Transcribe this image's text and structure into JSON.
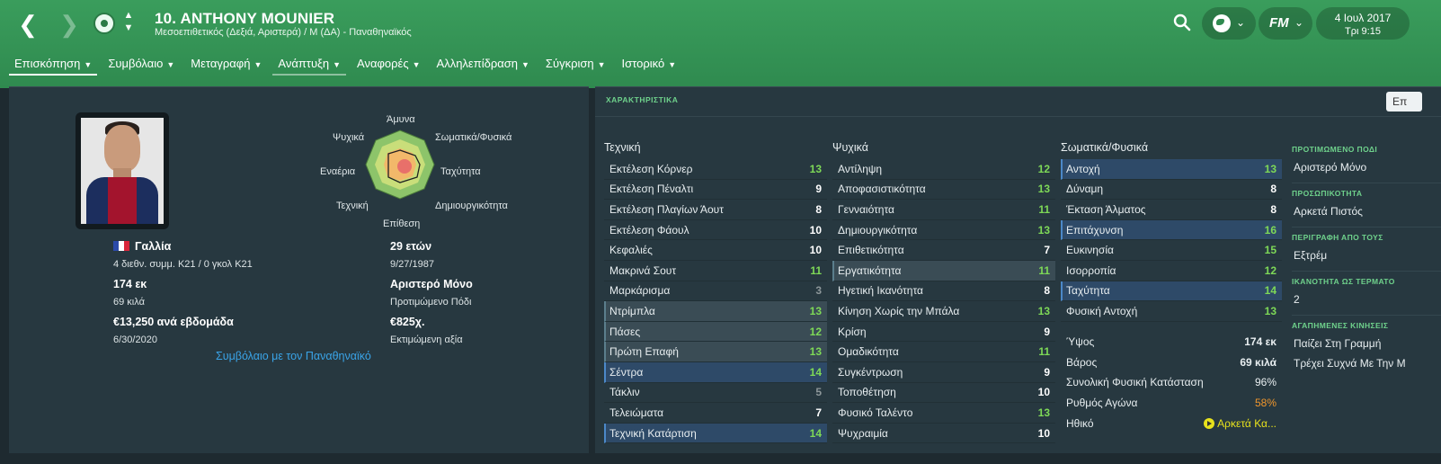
{
  "header": {
    "title": "10. ANTHONY MOUNIER",
    "subtitle": "Μεσοεπιθετικός (Δεξιά, Αριστερά) / Μ (ΔΑ) - Παναθηναϊκός",
    "date_line1": "4 Ιουλ 2017",
    "date_line2": "Τρι 9:15",
    "fm_label": "FM"
  },
  "tabs": [
    {
      "label": "Επισκόπηση"
    },
    {
      "label": "Συμβόλαιο"
    },
    {
      "label": "Μεταγραφή"
    },
    {
      "label": "Ανάπτυξη"
    },
    {
      "label": "Αναφορές"
    },
    {
      "label": "Αλληλεπίδραση"
    },
    {
      "label": "Σύγκριση"
    },
    {
      "label": "Ιστορικό"
    }
  ],
  "overview": {
    "radar_labels": {
      "top": "Άμυνα",
      "top_left": "Ψυχικά",
      "top_right": "Σωματικά/Φυσικά",
      "left": "Εναέρια",
      "right": "Ταχύτητα",
      "bottom_left": "Τεχνική",
      "bottom_right": "Δημιουργικότητα",
      "bottom": "Επίθεση"
    },
    "nationality": "Γαλλία",
    "caps": "4 διεθν. συμμ. K21 / 0 γκολ K21",
    "age": "29 ετών",
    "dob": "9/27/1987",
    "height": "174 εκ",
    "weight": "69 κιλά",
    "foot_value": "Αριστερό Μόνο",
    "foot_label": "Προτιμώμενο Πόδι",
    "wage": "€13,250 ανά εβδομάδα",
    "contract_end": "6/30/2020",
    "value": "€825χ.",
    "value_label": "Εκτιμώμενη αξία",
    "contract_link": "Συμβόλαιο με τον Παναθηναϊκό"
  },
  "attributes": {
    "title": "ΧΑΡΑΚΤΗΡΙΣΤΙΚΑ",
    "edit_label": "Επ",
    "technical": {
      "header": "Τεχνική",
      "rows": [
        {
          "name": "Εκτέλεση Κόρνερ",
          "value": "13"
        },
        {
          "name": "Εκτέλεση Πέναλτι",
          "value": "9"
        },
        {
          "name": "Εκτέλεση Πλαγίων Άουτ",
          "value": "8"
        },
        {
          "name": "Εκτέλεση Φάουλ",
          "value": "10"
        },
        {
          "name": "Κεφαλιές",
          "value": "10"
        },
        {
          "name": "Μακρινά Σουτ",
          "value": "11"
        },
        {
          "name": "Μαρκάρισμα",
          "value": "3"
        },
        {
          "name": "Ντρίμπλα",
          "value": "13"
        },
        {
          "name": "Πάσες",
          "value": "12"
        },
        {
          "name": "Πρώτη Επαφή",
          "value": "13"
        },
        {
          "name": "Σέντρα",
          "value": "14"
        },
        {
          "name": "Τάκλιν",
          "value": "5"
        },
        {
          "name": "Τελειώματα",
          "value": "7"
        },
        {
          "name": "Τεχνική Κατάρτιση",
          "value": "14"
        }
      ]
    },
    "mental": {
      "header": "Ψυχικά",
      "rows": [
        {
          "name": "Αντίληψη",
          "value": "12"
        },
        {
          "name": "Αποφασιστικότητα",
          "value": "13"
        },
        {
          "name": "Γενναιότητα",
          "value": "11"
        },
        {
          "name": "Δημιουργικότητα",
          "value": "13"
        },
        {
          "name": "Επιθετικότητα",
          "value": "7"
        },
        {
          "name": "Εργατικότητα",
          "value": "11"
        },
        {
          "name": "Ηγετική Ικανότητα",
          "value": "8"
        },
        {
          "name": "Κίνηση Χωρίς την Μπάλα",
          "value": "13"
        },
        {
          "name": "Κρίση",
          "value": "9"
        },
        {
          "name": "Ομαδικότητα",
          "value": "11"
        },
        {
          "name": "Συγκέντρωση",
          "value": "9"
        },
        {
          "name": "Τοποθέτηση",
          "value": "10"
        },
        {
          "name": "Φυσικό Ταλέντο",
          "value": "13"
        },
        {
          "name": "Ψυχραιμία",
          "value": "10"
        }
      ]
    },
    "physical": {
      "header": "Σωματικά/Φυσικά",
      "rows": [
        {
          "name": "Αντοχή",
          "value": "13"
        },
        {
          "name": "Δύναμη",
          "value": "8"
        },
        {
          "name": "Έκταση Άλματος",
          "value": "8"
        },
        {
          "name": "Επιτάχυνση",
          "value": "16"
        },
        {
          "name": "Ευκινησία",
          "value": "15"
        },
        {
          "name": "Ισορροπία",
          "value": "12"
        },
        {
          "name": "Ταχύτητα",
          "value": "14"
        },
        {
          "name": "Φυσική Αντοχή",
          "value": "13"
        }
      ]
    },
    "physical_stats": [
      {
        "name": "Ύψος",
        "value": "174 εκ"
      },
      {
        "name": "Βάρος",
        "value": "69 κιλά"
      },
      {
        "name": "Συνολική Φυσική Κατάσταση",
        "value": "96%"
      },
      {
        "name": "Ρυθμός Αγώνα",
        "value": "58%"
      },
      {
        "name": "Ηθικό",
        "value": "Αρκετά Κα..."
      }
    ]
  },
  "side": {
    "foot_head": "ΠΡΟΤΙΜΩΜΕΝΟ ΠΟΔΙ",
    "foot_value": "Αριστερό Μόνο",
    "personality_head": "ΠΡΟΣΩΠΙΚΟΤΗΤΑ",
    "personality_value": "Αρκετά Πιστός",
    "media_head": "ΠΕΡΙΓΡΑΦΗ ΑΠΟ ΤΟΥΣ",
    "media_value": "Εξτρέμ",
    "ability_head": "ΙΚΑΝΟΤΗΤΑ ΩΣ ΤΕΡΜΑΤΟ",
    "ability_value": "2",
    "moves_head": "ΑΓΑΠΗΜΕΝΕΣ ΚΙΝΗΣΕΙΣ",
    "move1": "Παίζει Στη Γραμμή",
    "move2": "Τρέχει Συχνά Με Την Μ"
  },
  "colors": {
    "header_green": "#3a9d5c",
    "panel_bg": "#273840",
    "value_green": "#7ed957",
    "value_orange": "#f0962c",
    "link_blue": "#3aa4e8"
  }
}
